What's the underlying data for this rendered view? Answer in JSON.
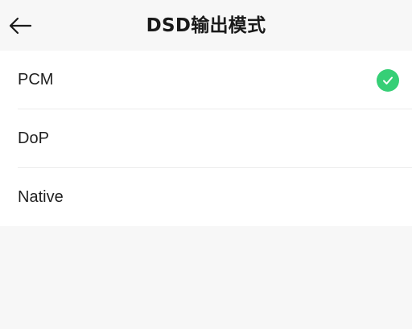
{
  "header": {
    "title": "DSD输出模式",
    "back_icon": "arrow-left-icon"
  },
  "options": [
    {
      "label": "PCM",
      "selected": true
    },
    {
      "label": "DoP",
      "selected": false
    },
    {
      "label": "Native",
      "selected": false
    }
  ],
  "colors": {
    "accent": "#36cf76",
    "background": "#f7f7f7",
    "list_background": "#ffffff"
  },
  "selected_icon": "check-circle-icon"
}
